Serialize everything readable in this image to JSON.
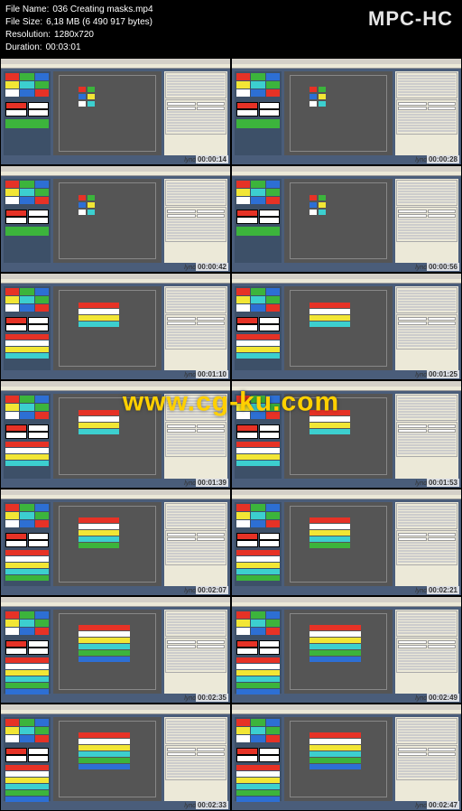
{
  "app_title": "MPC-HC",
  "info": {
    "filename_label": "File Name:",
    "filename": "036 Creating masks.mp4",
    "filesize_label": "File Size:",
    "filesize": "6,18 MB (6 490 917 bytes)",
    "resolution_label": "Resolution:",
    "resolution": "1280x720",
    "duration_label": "Duration:",
    "duration": "00:03:01"
  },
  "watermark": "www.cg-ku.com",
  "lynda_label": "lynda",
  "thumbnails": [
    {
      "ts": "00:00:14",
      "variant": "small-swatches"
    },
    {
      "ts": "00:00:28",
      "variant": "small-swatches"
    },
    {
      "ts": "00:00:42",
      "variant": "small-swatches"
    },
    {
      "ts": "00:00:56",
      "variant": "small-swatches"
    },
    {
      "ts": "00:01:10",
      "variant": "bars-short"
    },
    {
      "ts": "00:01:25",
      "variant": "bars-short"
    },
    {
      "ts": "00:01:39",
      "variant": "bars-short"
    },
    {
      "ts": "00:01:53",
      "variant": "bars-short"
    },
    {
      "ts": "00:02:07",
      "variant": "bars-medium"
    },
    {
      "ts": "00:02:21",
      "variant": "bars-medium"
    },
    {
      "ts": "00:02:35",
      "variant": "bars-long"
    },
    {
      "ts": "00:02:49",
      "variant": "bars-long"
    },
    {
      "ts": "00:02:33",
      "variant": "bars-long"
    },
    {
      "ts": "00:02:47",
      "variant": "bars-long"
    }
  ]
}
